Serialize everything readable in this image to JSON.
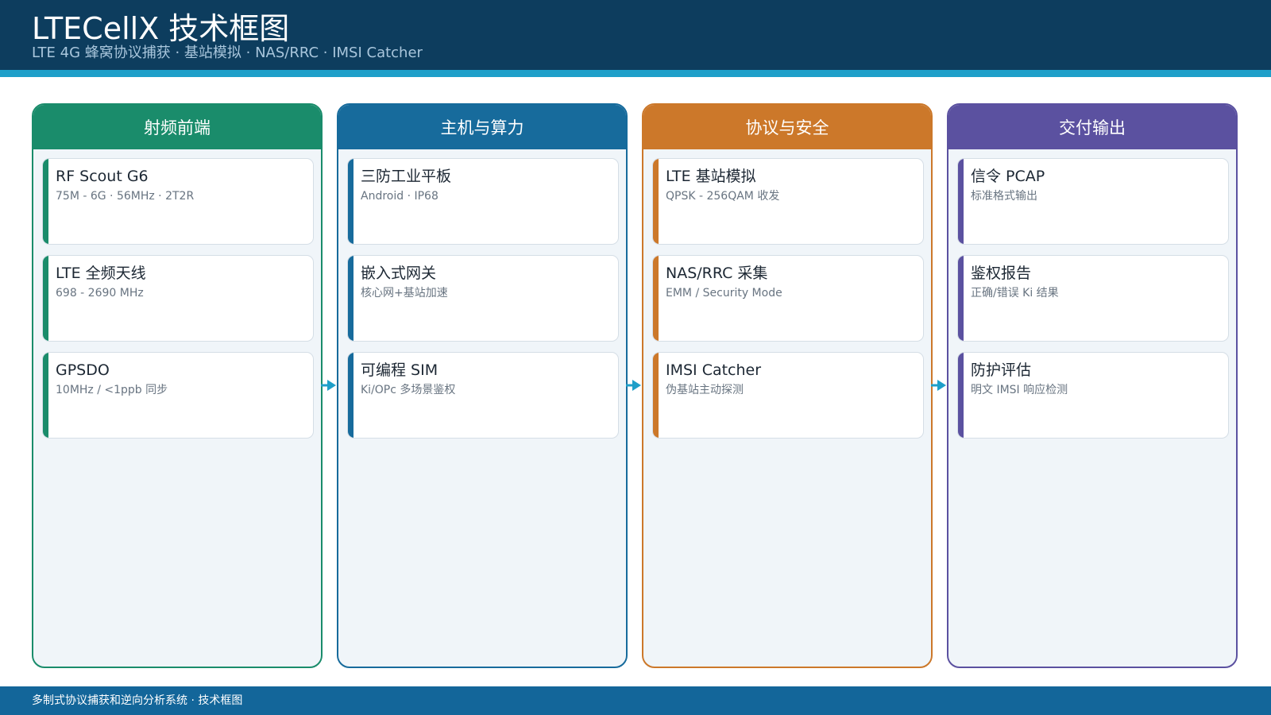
{
  "header": {
    "title": "LTECellX 技术框图",
    "subtitle": "LTE 4G 蜂窝协议捕获 · 基站模拟 · NAS/RRC · IMSI Catcher"
  },
  "columns": [
    {
      "title": "射频前端",
      "color": "#1a8c6b",
      "cards": [
        {
          "title": "RF Scout G6",
          "sub": "75M - 6G · 56MHz · 2T2R"
        },
        {
          "title": "LTE 全频天线",
          "sub": "698 - 2690 MHz"
        },
        {
          "title": "GPSDO",
          "sub": "10MHz / <1ppb 同步"
        }
      ]
    },
    {
      "title": "主机与算力",
      "color": "#176b9c",
      "cards": [
        {
          "title": "三防工业平板",
          "sub": "Android · IP68"
        },
        {
          "title": "嵌入式网关",
          "sub": "核心网+基站加速"
        },
        {
          "title": "可编程 SIM",
          "sub": "Ki/OPc 多场景鉴权"
        }
      ]
    },
    {
      "title": "协议与安全",
      "color": "#cc782a",
      "cards": [
        {
          "title": "LTE 基站模拟",
          "sub": "QPSK - 256QAM 收发"
        },
        {
          "title": "NAS/RRC 采集",
          "sub": "EMM / Security Mode"
        },
        {
          "title": "IMSI Catcher",
          "sub": "伪基站主动探测"
        }
      ]
    },
    {
      "title": "交付输出",
      "color": "#5b51a0",
      "cards": [
        {
          "title": "信令 PCAP",
          "sub": "标准格式输出"
        },
        {
          "title": "鉴权报告",
          "sub": "正确/错误 Ki 结果"
        },
        {
          "title": "防护评估",
          "sub": "明文 IMSI 响应检测"
        }
      ]
    }
  ],
  "arrow_color": "#1e9fc9",
  "footer": {
    "text": "多制式协议捕获和逆向分析系统 · 技术框图"
  }
}
